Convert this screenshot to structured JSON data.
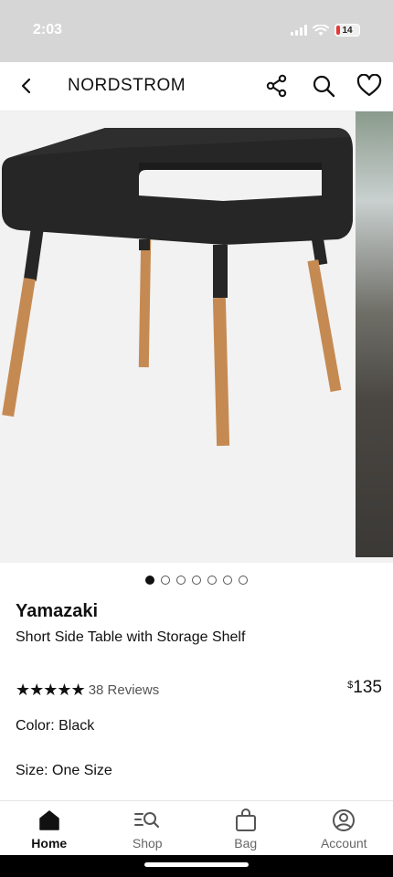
{
  "status_bar": {
    "time": "2:03",
    "battery_level": "14",
    "icons": [
      "signal-icon",
      "wifi-icon",
      "battery-icon"
    ]
  },
  "header": {
    "brand": "NORDSTROM",
    "icons": [
      "back-chevron-icon",
      "share-icon",
      "search-icon",
      "heart-icon"
    ]
  },
  "gallery": {
    "current_index": 1,
    "dot_count": 7
  },
  "product": {
    "brand": "Yamazaki",
    "title": "Short Side Table with Storage Shelf",
    "stars": "★★★★★",
    "rating": 5,
    "reviews": "38 Reviews",
    "price_symbol": "$",
    "price_value": "135",
    "color": "Color: Black",
    "size": "Size: One Size"
  },
  "tab_bar": {
    "tabs": [
      {
        "label": "Home",
        "icon": "home-icon",
        "active": true
      },
      {
        "label": "Shop",
        "icon": "shop-search-icon",
        "active": false
      },
      {
        "label": "Bag",
        "icon": "bag-icon",
        "active": false
      },
      {
        "label": "Account",
        "icon": "account-icon",
        "active": false
      }
    ]
  },
  "colors": {
    "status_bar_bg": "#d6d6d6",
    "table_black": "#262626",
    "wood": "#c58a52",
    "accent": "#111111"
  }
}
